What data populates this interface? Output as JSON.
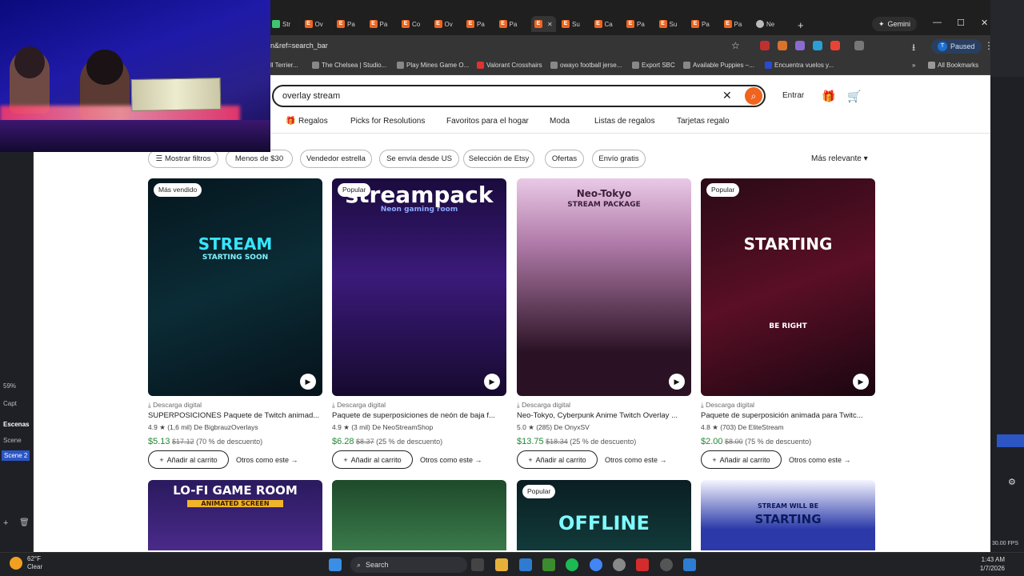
{
  "tabs": [
    {
      "label": "Str",
      "kind": "green"
    },
    {
      "label": "Ov",
      "kind": "etsy"
    },
    {
      "label": "Pa",
      "kind": "etsy"
    },
    {
      "label": "Pa",
      "kind": "etsy"
    },
    {
      "label": "Co",
      "kind": "etsy"
    },
    {
      "label": "Ov",
      "kind": "etsy"
    },
    {
      "label": "Pa",
      "kind": "etsy"
    },
    {
      "label": "Pa",
      "kind": "etsy"
    },
    {
      "label": "",
      "kind": "etsy-active"
    },
    {
      "label": "Su",
      "kind": "etsy"
    },
    {
      "label": "Ca",
      "kind": "etsy"
    },
    {
      "label": "Pa",
      "kind": "etsy"
    },
    {
      "label": "Su",
      "kind": "etsy"
    },
    {
      "label": "Pa",
      "kind": "etsy"
    },
    {
      "label": "Pa",
      "kind": "etsy"
    },
    {
      "label": "Ne",
      "kind": "globe"
    }
  ],
  "browser": {
    "gemini_label": "Gemini",
    "url": "n&ref=search_bar",
    "profile_label": "Paused",
    "profile_initial": "T",
    "all_bookmarks": "All Bookmarks"
  },
  "bookmarks": [
    "ll Terrier...",
    "The Chelsea | Studio...",
    "Play Mines Game O...",
    "Valorant Crosshairs",
    "owayo football jerse...",
    "Export SBC",
    "Available Puppies –...",
    "Encuentra vuelos y..."
  ],
  "etsy": {
    "search_value": "overlay stream",
    "signin": "Entrar",
    "nav": [
      "Regalos",
      "Picks for Resolutions",
      "Favoritos para el hogar",
      "Moda",
      "Listas de regalos",
      "Tarjetas regalo"
    ],
    "filters": [
      "Mostrar filtros",
      "Menos de $30",
      "Vendedor estrella",
      "Se envía desde US",
      "Selección de Etsy",
      "Ofertas",
      "Envío gratis"
    ],
    "sort": "Más relevante",
    "listings": [
      {
        "badge": "Más vendido",
        "kind": "Descarga digital",
        "title": "SUPERPOSICIONES Paquete de Twitch animad...",
        "rating": "4.9",
        "reviews": "(1,6 mil)",
        "shop": "De BigbrauzOverlays",
        "price": "$5.13",
        "old": "$17.12",
        "discount": "(70 % de descuento)",
        "thumb_text": "STREAM",
        "thumb_sub": "STARTING SOON"
      },
      {
        "badge": "Popular",
        "kind": "Descarga digital",
        "title": "Paquete de superposiciones de neón de baja f...",
        "rating": "4.9",
        "reviews": "(3 mil)",
        "shop": "De NeoStreamShop",
        "price": "$6.28",
        "old": "$8.37",
        "discount": "(25 % de descuento)",
        "thumb_text": "streampack",
        "thumb_sub": "Neon gaming room"
      },
      {
        "badge": "",
        "kind": "Descarga digital",
        "title": "Neo-Tokyo, Cyberpunk Anime Twitch Overlay ...",
        "rating": "5.0",
        "reviews": "(285)",
        "shop": "De OnyxSV",
        "price": "$13.75",
        "old": "$18.34",
        "discount": "(25 % de descuento)",
        "thumb_text": "Neo-Tokyo",
        "thumb_sub": "STREAM PACKAGE"
      },
      {
        "badge": "Popular",
        "kind": "Descarga digital",
        "title": "Paquete de superposición animada para Twitc...",
        "rating": "4.8",
        "reviews": "(703)",
        "shop": "De EliteStream",
        "price": "$2.00",
        "old": "$8.00",
        "discount": "(75 % de descuento)",
        "thumb_text": "STARTING",
        "thumb_sub": "BE RIGHT"
      }
    ],
    "add_to_cart": "Añadir al carrito",
    "see_more": "Otros como este",
    "row2": [
      {
        "badge": "",
        "text": "LO-FI GAME ROOM",
        "sub": "ANIMATED SCREEN"
      },
      {
        "badge": "",
        "text": "",
        "sub": ""
      },
      {
        "badge": "Popular",
        "text": "OFFLINE",
        "sub": ""
      },
      {
        "badge": "",
        "text": "STARTING",
        "sub": "STREAM WILL BE"
      }
    ]
  },
  "obs": {
    "zoom": "59%",
    "capture": "Capt",
    "scenes_header": "Escenas",
    "scenes": [
      "Scene",
      "Scene 2"
    ],
    "fps": "30.00 FPS"
  },
  "taskbar": {
    "temp": "62°F",
    "weather": "Clear",
    "search": "Search",
    "time": "1:43 AM",
    "date": "1/7/2026"
  },
  "colors": {
    "etsy_orange": "#f1641e",
    "price_green": "#258635"
  }
}
